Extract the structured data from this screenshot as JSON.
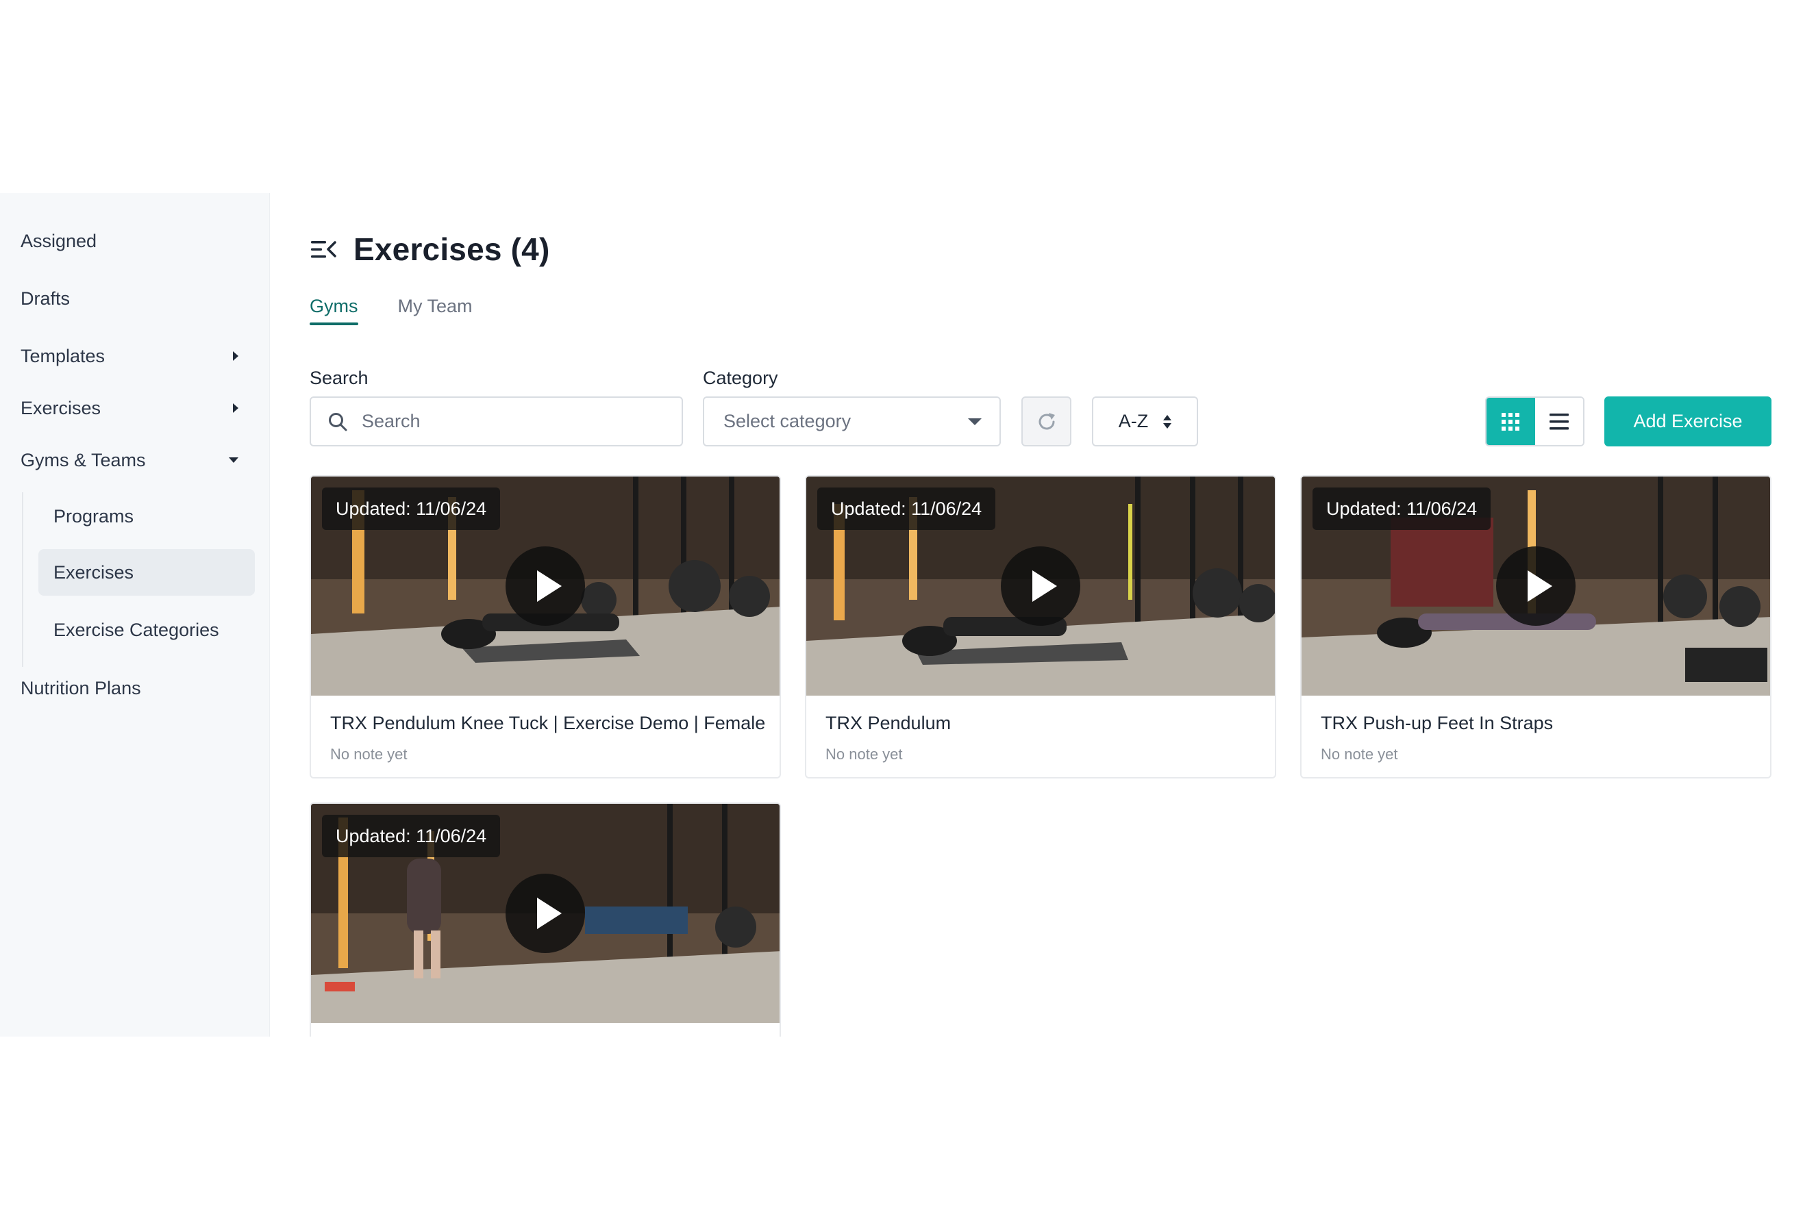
{
  "sidebar": {
    "items": [
      {
        "label": "Assigned"
      },
      {
        "label": "Drafts"
      },
      {
        "label": "Templates"
      },
      {
        "label": "Exercises"
      },
      {
        "label": "Gyms & Teams"
      },
      {
        "label": "Nutrition Plans"
      }
    ],
    "sub_items": [
      {
        "label": "Programs"
      },
      {
        "label": "Exercises",
        "active": true
      },
      {
        "label": "Exercise Categories"
      }
    ]
  },
  "header": {
    "title": "Exercises (4)"
  },
  "tabs": [
    {
      "label": "Gyms",
      "active": true
    },
    {
      "label": "My Team",
      "active": false
    }
  ],
  "filters": {
    "search_label": "Search",
    "search_placeholder": "Search",
    "search_value": "",
    "category_label": "Category",
    "category_placeholder": "Select category",
    "sort_label": "A-Z"
  },
  "toolbar": {
    "view_mode": "grid",
    "add_label": "Add Exercise"
  },
  "colors": {
    "accent": "#12b5ab",
    "tab_active": "#0f6d68"
  },
  "exercises": [
    {
      "updated": "Updated: 11/06/24",
      "title": "TRX Pendulum Knee Tuck | Exercise Demo | Female",
      "note": "No note yet"
    },
    {
      "updated": "Updated: 11/06/24",
      "title": "TRX Pendulum",
      "note": "No note yet"
    },
    {
      "updated": "Updated: 11/06/24",
      "title": "TRX Push-up Feet In Straps",
      "note": "No note yet"
    },
    {
      "updated": "Updated: 11/06/24",
      "title": "",
      "note": ""
    }
  ]
}
